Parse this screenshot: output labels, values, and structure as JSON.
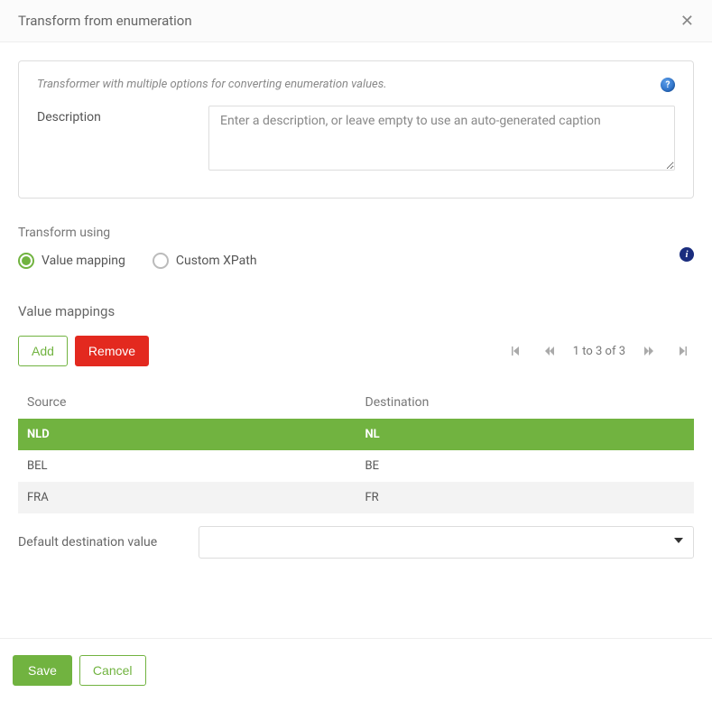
{
  "header": {
    "title": "Transform from enumeration"
  },
  "descriptionBox": {
    "hint": "Transformer with multiple options for converting enumeration values.",
    "label": "Description",
    "placeholder": "Enter a description, or leave empty to use an auto-generated caption"
  },
  "transformUsing": {
    "label": "Transform using",
    "options": {
      "valueMapping": "Value mapping",
      "customXpath": "Custom XPath"
    },
    "selected": "valueMapping"
  },
  "mappings": {
    "title": "Value mappings",
    "addLabel": "Add",
    "removeLabel": "Remove",
    "pagination": "1 to 3 of 3",
    "columns": {
      "source": "Source",
      "destination": "Destination"
    },
    "rows": [
      {
        "source": "NLD",
        "destination": "NL",
        "selected": true
      },
      {
        "source": "BEL",
        "destination": "BE",
        "selected": false
      },
      {
        "source": "FRA",
        "destination": "FR",
        "selected": false
      }
    ]
  },
  "defaultDestination": {
    "label": "Default destination value",
    "value": ""
  },
  "footer": {
    "save": "Save",
    "cancel": "Cancel"
  }
}
